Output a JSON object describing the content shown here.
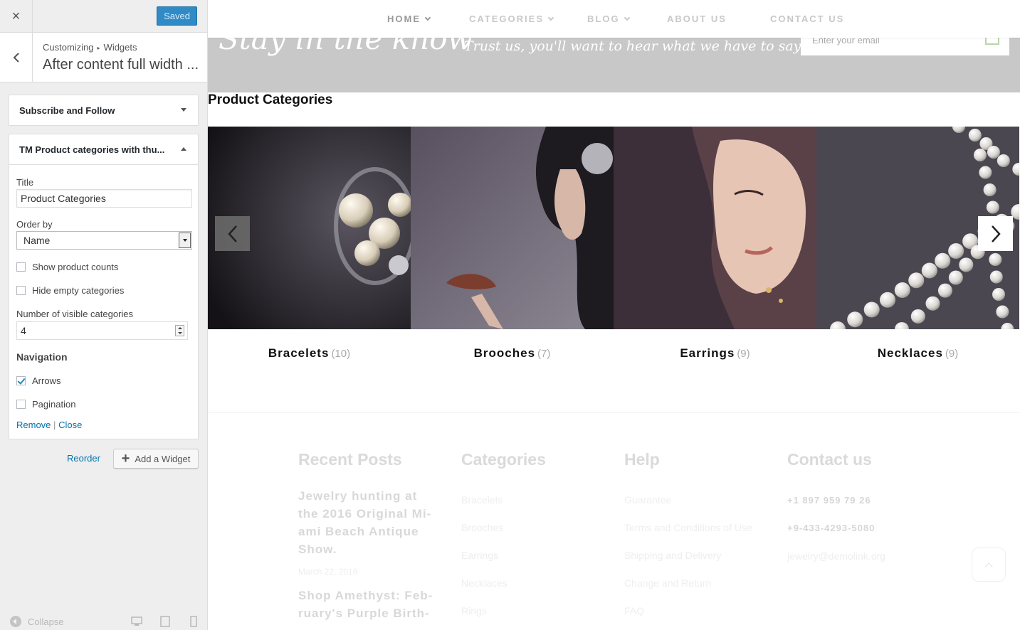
{
  "sidebar": {
    "close_label": "×",
    "saved_label": "Saved",
    "breadcrumb": {
      "root": "Customizing",
      "separator": "▸",
      "section": "Widgets"
    },
    "title": "After content full width ...",
    "collapsed_widget": "Subscribe and Follow",
    "expanded_widget": "TM Product categories with thu...",
    "form": {
      "title_label": "Title",
      "title_value": "Product Categories",
      "order_label": "Order by",
      "order_value": "Name",
      "show_counts_label": "Show product counts",
      "show_counts_checked": false,
      "hide_empty_label": "Hide empty categories",
      "hide_empty_checked": false,
      "visible_label": "Number of visible categories",
      "visible_value": "4",
      "navigation_heading": "Navigation",
      "arrows_label": "Arrows",
      "arrows_checked": true,
      "pagination_label": "Pagination",
      "pagination_checked": false,
      "remove_label": "Remove",
      "link_separator": "|",
      "close_label": "Close"
    },
    "reorder_label": "Reorder",
    "add_widget_label": "Add a Widget",
    "collapse_label": "Collapse"
  },
  "preview": {
    "nav": [
      {
        "label": "HOME",
        "has_dropdown": true,
        "active": true
      },
      {
        "label": "CATEGORIES",
        "has_dropdown": true,
        "active": false
      },
      {
        "label": "BLOG",
        "has_dropdown": true,
        "active": false
      },
      {
        "label": "ABOUT US",
        "has_dropdown": false,
        "active": false
      },
      {
        "label": "CONTACT US",
        "has_dropdown": false,
        "active": false
      }
    ],
    "newsletter": {
      "headline": "Stay in the know",
      "tagline": "Trust us, you'll want to hear what we have to say",
      "email_placeholder": "Enter your email"
    },
    "section_title": "Product Categories",
    "categories": [
      {
        "name": "Bracelets",
        "count": "(10)"
      },
      {
        "name": "Brooches",
        "count": "(7)"
      },
      {
        "name": "Earrings",
        "count": "(9)"
      },
      {
        "name": "Necklaces",
        "count": "(9)"
      }
    ],
    "footer": {
      "recent_posts": {
        "heading": "Recent Posts",
        "posts": [
          {
            "title": "Jewelry hunting at the 2016 Original Mi-ami Beach Antique Show.",
            "date": "March 22, 2016"
          },
          {
            "title": "Shop Amethyst: Feb-ruary's Purple Birth-"
          }
        ]
      },
      "categories": {
        "heading": "Categories",
        "links": [
          "Bracelets",
          "Brooches",
          "Earrings",
          "Necklaces",
          "Rings"
        ]
      },
      "help": {
        "heading": "Help",
        "links": [
          "Guarantee",
          "Terms and Conditions of Use",
          "Shipping and Delivery",
          "Change and Return",
          "FAQ"
        ]
      },
      "contact": {
        "heading": "Contact us",
        "phone1": "+1 897 959 79 26",
        "phone2": "+9-433-4293-5080",
        "email": "jewelry@demolink.org"
      }
    }
  },
  "colors": {
    "accent": "#0073aa",
    "saved_button": "#2f8ac6",
    "newsletter_band": "#c8c8c8"
  }
}
